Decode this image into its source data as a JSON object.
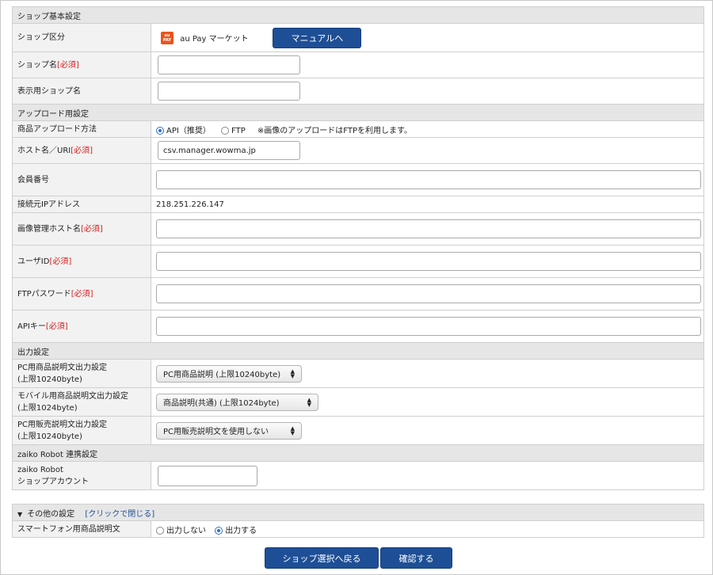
{
  "colors": {
    "required": "#d81e1e",
    "primary_button": "#1e4f96",
    "label_bg": "#f2f2f2",
    "section_bg": "#e6e6e6"
  },
  "required_mark": "[必須]",
  "basic": {
    "section_title": "ショップ基本設定",
    "shop_type_label": "ショップ区分",
    "shop_logo_text_top": "au",
    "shop_logo_text_bottom": "PAY",
    "shop_type_value": "au Pay マーケット",
    "manual_button": "マニュアルへ",
    "shop_name_label": "ショップ名",
    "shop_name_value": "",
    "display_shop_name_label": "表示用ショップ名",
    "display_shop_name_value": ""
  },
  "upload": {
    "section_title": "アップロード用設定",
    "method_label": "商品アップロード方法",
    "method_options": [
      "API（推奨）",
      "FTP"
    ],
    "method_selected": "API（推奨）",
    "method_note": "※画像のアップロードはFTPを利用します。",
    "host_label": "ホスト名／URI",
    "host_value": "csv.manager.wowma.jp",
    "member_no_label": "会員番号",
    "member_no_value": "",
    "ip_label": "接続元IPアドレス",
    "ip_value": "218.251.226.147",
    "image_host_label": "画像管理ホスト名",
    "image_host_value": "",
    "user_id_label": "ユーザID",
    "user_id_value": "",
    "ftp_password_label": "FTPパスワード",
    "ftp_password_value": "",
    "api_key_label": "APIキー",
    "api_key_value": ""
  },
  "output": {
    "section_title": "出力設定",
    "pc_desc_label_1": "PC用商品説明文出力設定",
    "pc_desc_label_2": "(上限10240byte)",
    "pc_desc_value": "PC用商品説明 (上限10240byte)",
    "mobile_desc_label_1": "モバイル用商品説明文出力設定",
    "mobile_desc_label_2": "(上限1024byte)",
    "mobile_desc_value": "商品説明(共通) (上限1024byte)",
    "pc_sales_label_1": "PC用販売説明文出力設定",
    "pc_sales_label_2": "(上限10240byte)",
    "pc_sales_value": "PC用販売説明文を使用しない"
  },
  "zaiko": {
    "section_title": "zaiko Robot 連携設定",
    "account_label_1": "zaiko Robot",
    "account_label_2": "ショップアカウント",
    "account_value": ""
  },
  "other": {
    "section_title": "その他の設定",
    "toggle_link": "[クリックで閉じる]",
    "smartphone_label": "スマートフォン用商品説明文",
    "smartphone_options": [
      "出力しない",
      "出力する"
    ],
    "smartphone_selected": "出力する"
  },
  "footer": {
    "back_button": "ショップ選択へ戻る",
    "confirm_button": "確認する"
  }
}
